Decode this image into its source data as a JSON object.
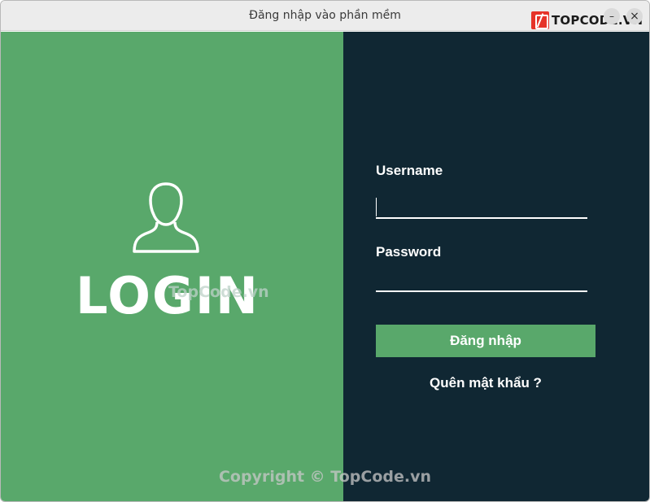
{
  "window": {
    "title": "Đăng nhập vào phần mềm",
    "minimize_symbol": "–",
    "close_symbol": "×"
  },
  "brand": {
    "text": "TOPCODE.VN",
    "icon": "topcode-logo-icon",
    "color": "#e63329"
  },
  "left_panel": {
    "icon": "user-icon",
    "heading": "LOGIN",
    "watermark": "TopCode.vn",
    "color": "#59a86b"
  },
  "right_panel": {
    "color": "#102733"
  },
  "form": {
    "username_label": "Username",
    "username_value": "",
    "password_label": "Password",
    "password_value": "",
    "login_button": "Đăng nhập",
    "forgot_link": "Quên mật khẩu ?"
  },
  "footer": {
    "copyright": "Copyright © TopCode.vn"
  }
}
